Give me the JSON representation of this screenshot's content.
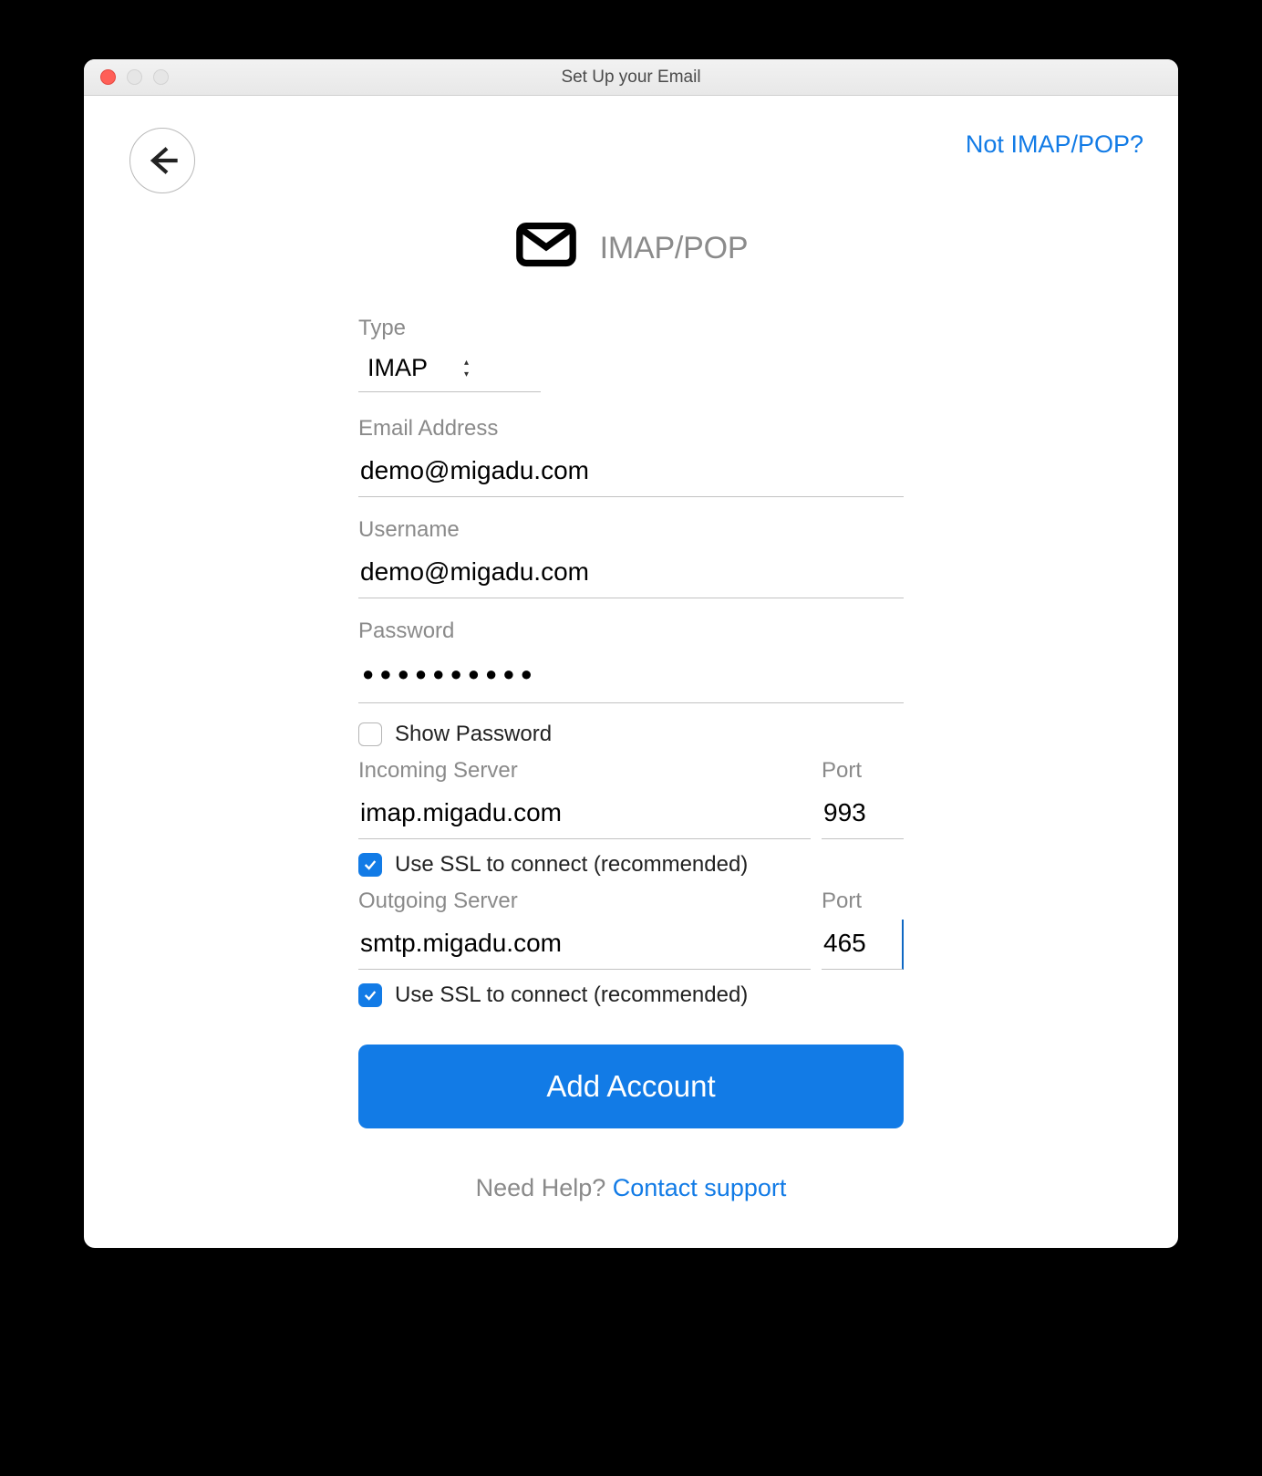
{
  "window": {
    "title": "Set Up your Email"
  },
  "header": {
    "not_link": "Not IMAP/POP?",
    "protocol": "IMAP/POP"
  },
  "form": {
    "type": {
      "label": "Type",
      "value": "IMAP"
    },
    "email": {
      "label": "Email Address",
      "value": "demo@migadu.com"
    },
    "username": {
      "label": "Username",
      "value": "demo@migadu.com"
    },
    "password": {
      "label": "Password",
      "masked": "●●●●●●●●●●"
    },
    "show_password": {
      "label": "Show Password",
      "checked": false
    },
    "incoming": {
      "label": "Incoming Server",
      "value": "imap.migadu.com",
      "port_label": "Port",
      "port": "993",
      "ssl_label": "Use SSL to connect (recommended)",
      "ssl_checked": true
    },
    "outgoing": {
      "label": "Outgoing Server",
      "value": "smtp.migadu.com",
      "port_label": "Port",
      "port": "465",
      "ssl_label": "Use SSL to connect (recommended)",
      "ssl_checked": true
    },
    "submit": "Add Account"
  },
  "help": {
    "prefix": "Need Help? ",
    "link": "Contact support"
  }
}
